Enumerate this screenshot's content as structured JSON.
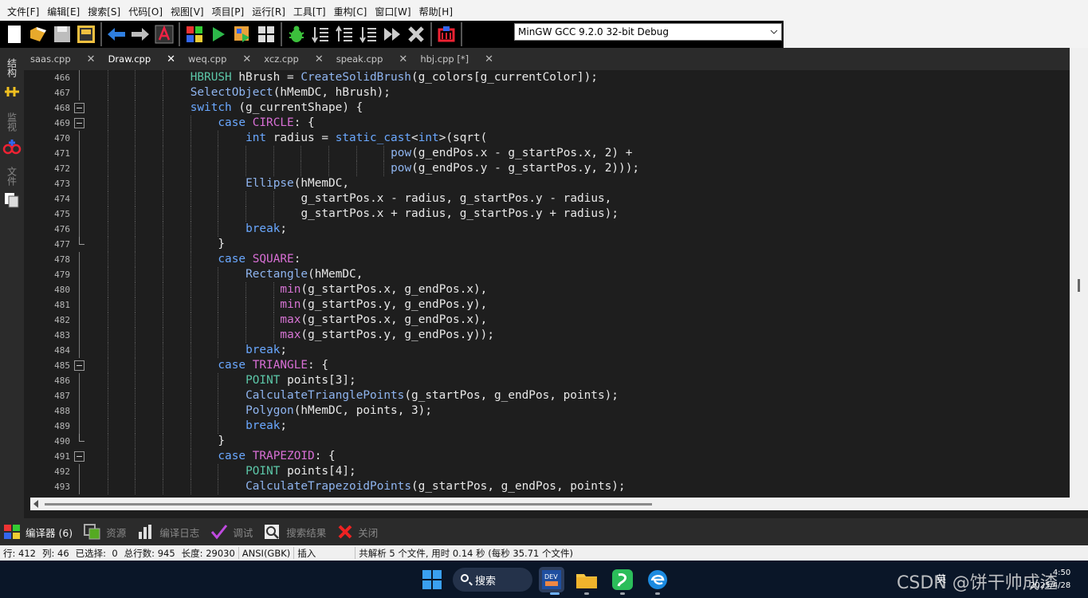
{
  "menu": [
    "文件[F]",
    "编辑[E]",
    "搜索[S]",
    "代码[O]",
    "视图[V]",
    "项目[P]",
    "运行[R]",
    "工具[T]",
    "重构[C]",
    "窗口[W]",
    "帮助[H]"
  ],
  "toolbar": {
    "compiler": "MinGW GCC 9.2.0 32-bit Debug"
  },
  "side_panel": {
    "items": [
      "结构",
      "监视",
      "文件"
    ]
  },
  "tabs": [
    {
      "label": "saas.cpp",
      "active": false
    },
    {
      "label": "Draw.cpp",
      "active": true
    },
    {
      "label": "weq.cpp",
      "active": false
    },
    {
      "label": "xcz.cpp",
      "active": false
    },
    {
      "label": "speak.cpp",
      "active": false
    },
    {
      "label": "hbj.cpp [*]",
      "active": false
    }
  ],
  "tab_close": "✕",
  "editor": {
    "lines": [
      {
        "n": "466",
        "fold": "line",
        "indent": 4,
        "tokens": [
          [
            "ty",
            "HBRUSH"
          ],
          [
            "plain",
            " hBrush = "
          ],
          [
            "fn",
            "CreateSolidBrush"
          ],
          [
            "plain",
            "(g_colors[g_currentColor]);"
          ]
        ]
      },
      {
        "n": "467",
        "fold": "line",
        "indent": 4,
        "tokens": [
          [
            "fn",
            "SelectObject"
          ],
          [
            "plain",
            "(hMemDC, hBrush);"
          ]
        ]
      },
      {
        "n": "468",
        "fold": "box",
        "indent": 4,
        "tokens": [
          [
            "kw",
            "switch"
          ],
          [
            "plain",
            " (g_currentShape) {"
          ]
        ]
      },
      {
        "n": "469",
        "fold": "box",
        "indent": 5,
        "tokens": [
          [
            "kw",
            "case"
          ],
          [
            "plain",
            " "
          ],
          [
            "mac",
            "CIRCLE"
          ],
          [
            "plain",
            ": {"
          ]
        ]
      },
      {
        "n": "470",
        "fold": "line",
        "indent": 6,
        "tokens": [
          [
            "kw",
            "int"
          ],
          [
            "plain",
            " radius = "
          ],
          [
            "kw",
            "static_cast"
          ],
          [
            "plain",
            "<"
          ],
          [
            "kw",
            "int"
          ],
          [
            "plain",
            ">(sqrt("
          ]
        ]
      },
      {
        "n": "471",
        "fold": "line",
        "indent": 6,
        "pad": "                     ",
        "tokens": [
          [
            "fn",
            "pow"
          ],
          [
            "plain",
            "(g_endPos.x - g_startPos.x, 2) +"
          ]
        ]
      },
      {
        "n": "472",
        "fold": "line",
        "indent": 6,
        "pad": "                     ",
        "tokens": [
          [
            "fn",
            "pow"
          ],
          [
            "plain",
            "(g_endPos.y - g_startPos.y, 2)));"
          ]
        ]
      },
      {
        "n": "473",
        "fold": "line",
        "indent": 6,
        "tokens": [
          [
            "fn",
            "Ellipse"
          ],
          [
            "plain",
            "(hMemDC,"
          ]
        ]
      },
      {
        "n": "474",
        "fold": "line",
        "indent": 8,
        "tokens": [
          [
            "plain",
            "g_startPos.x - radius, g_startPos.y - radius,"
          ]
        ]
      },
      {
        "n": "475",
        "fold": "line",
        "indent": 8,
        "tokens": [
          [
            "plain",
            "g_startPos.x + radius, g_startPos.y + radius);"
          ]
        ]
      },
      {
        "n": "476",
        "fold": "line",
        "indent": 6,
        "tokens": [
          [
            "kw",
            "break"
          ],
          [
            "plain",
            ";"
          ]
        ]
      },
      {
        "n": "477",
        "fold": "end",
        "indent": 5,
        "tokens": [
          [
            "plain",
            "}"
          ]
        ]
      },
      {
        "n": "478",
        "fold": "line",
        "indent": 5,
        "tokens": [
          [
            "kw",
            "case"
          ],
          [
            "plain",
            " "
          ],
          [
            "mac",
            "SQUARE"
          ],
          [
            "plain",
            ":"
          ]
        ]
      },
      {
        "n": "479",
        "fold": "line",
        "indent": 6,
        "tokens": [
          [
            "fn",
            "Rectangle"
          ],
          [
            "plain",
            "(hMemDC,"
          ]
        ]
      },
      {
        "n": "480",
        "fold": "line",
        "indent": 6,
        "pad": "     ",
        "tokens": [
          [
            "const",
            "min"
          ],
          [
            "plain",
            "(g_startPos.x, g_endPos.x),"
          ]
        ]
      },
      {
        "n": "481",
        "fold": "line",
        "indent": 6,
        "pad": "     ",
        "tokens": [
          [
            "const",
            "min"
          ],
          [
            "plain",
            "(g_startPos.y, g_endPos.y),"
          ]
        ]
      },
      {
        "n": "482",
        "fold": "line",
        "indent": 6,
        "pad": "     ",
        "tokens": [
          [
            "const",
            "max"
          ],
          [
            "plain",
            "(g_startPos.x, g_endPos.x),"
          ]
        ]
      },
      {
        "n": "483",
        "fold": "line",
        "indent": 6,
        "pad": "     ",
        "tokens": [
          [
            "const",
            "max"
          ],
          [
            "plain",
            "(g_startPos.y, g_endPos.y));"
          ]
        ]
      },
      {
        "n": "484",
        "fold": "line",
        "indent": 6,
        "tokens": [
          [
            "kw",
            "break"
          ],
          [
            "plain",
            ";"
          ]
        ]
      },
      {
        "n": "485",
        "fold": "box",
        "indent": 5,
        "tokens": [
          [
            "kw",
            "case"
          ],
          [
            "plain",
            " "
          ],
          [
            "mac",
            "TRIANGLE"
          ],
          [
            "plain",
            ": {"
          ]
        ]
      },
      {
        "n": "486",
        "fold": "line",
        "indent": 6,
        "tokens": [
          [
            "ty",
            "POINT"
          ],
          [
            "plain",
            " points[3];"
          ]
        ]
      },
      {
        "n": "487",
        "fold": "line",
        "indent": 6,
        "tokens": [
          [
            "fn",
            "CalculateTrianglePoints"
          ],
          [
            "plain",
            "(g_startPos, g_endPos, points);"
          ]
        ]
      },
      {
        "n": "488",
        "fold": "line",
        "indent": 6,
        "tokens": [
          [
            "fn",
            "Polygon"
          ],
          [
            "plain",
            "(hMemDC, points, 3);"
          ]
        ]
      },
      {
        "n": "489",
        "fold": "line",
        "indent": 6,
        "tokens": [
          [
            "kw",
            "break"
          ],
          [
            "plain",
            ";"
          ]
        ]
      },
      {
        "n": "490",
        "fold": "end",
        "indent": 5,
        "tokens": [
          [
            "plain",
            "}"
          ]
        ]
      },
      {
        "n": "491",
        "fold": "box",
        "indent": 5,
        "tokens": [
          [
            "kw",
            "case"
          ],
          [
            "plain",
            " "
          ],
          [
            "mac",
            "TRAPEZOID"
          ],
          [
            "plain",
            ": {"
          ]
        ]
      },
      {
        "n": "492",
        "fold": "line",
        "indent": 6,
        "tokens": [
          [
            "ty",
            "POINT"
          ],
          [
            "plain",
            " points[4];"
          ]
        ]
      },
      {
        "n": "493",
        "fold": "line",
        "indent": 6,
        "tokens": [
          [
            "fn",
            "CalculateTrapezoidPoints"
          ],
          [
            "plain",
            "(g_startPos, g_endPos, points);"
          ]
        ]
      }
    ]
  },
  "bottom_tabs": [
    {
      "label": "编译器 (6)",
      "icon": "grid-icon",
      "active": true
    },
    {
      "label": "资源",
      "icon": "resources-icon",
      "active": false
    },
    {
      "label": "编译日志",
      "icon": "bar-chart-icon",
      "active": false
    },
    {
      "label": "调试",
      "icon": "check-icon",
      "active": false
    },
    {
      "label": "搜索结果",
      "icon": "search-results-icon",
      "active": false
    },
    {
      "label": "关闭",
      "icon": "close-icon",
      "active": false
    }
  ],
  "status": {
    "row_label": "行:",
    "row": "412",
    "col_label": "列:",
    "col": "46",
    "sel_label": "已选择:",
    "sel": "0",
    "total_label": "总行数:",
    "total": "945",
    "length_label": "长度:",
    "length": "29030",
    "encoding": "ANSI(GBK)",
    "mode": "插入",
    "message": "共解析 5 个文件, 用时 0.14 秒 (每秒 35.71 个文件)"
  },
  "taskbar": {
    "search": "搜索",
    "watermark": "CSDN @饼干帅成渣",
    "tray_text": "英",
    "time": "4:50",
    "date": "2025/4/28"
  },
  "colors": {
    "keyword": "#6aa8ff",
    "type": "#5cc7a8",
    "function": "#8fb5f0",
    "macro": "#d86fd5",
    "background": "#1e1e1e"
  }
}
